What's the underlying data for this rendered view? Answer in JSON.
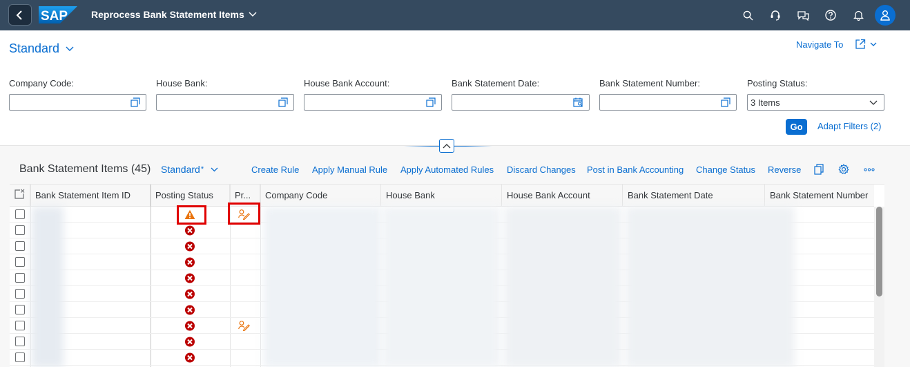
{
  "shell": {
    "logo_text": "SAP",
    "app_title": "Reprocess Bank Statement Items",
    "brand_color": "#354a5f",
    "icons": [
      "search-icon",
      "support-icon",
      "feedback-icon",
      "help-icon",
      "notifications-icon",
      "user-avatar-icon"
    ]
  },
  "header": {
    "variant": "Standard",
    "navigate_to": "Navigate To"
  },
  "filters": [
    {
      "label": "Company Code:",
      "value": ""
    },
    {
      "label": "House Bank:",
      "value": ""
    },
    {
      "label": "House Bank Account:",
      "value": ""
    },
    {
      "label": "Bank Statement Date:",
      "value": ""
    },
    {
      "label": "Bank Statement Number:",
      "value": ""
    },
    {
      "label": "Posting Status:",
      "value": "3 Items"
    }
  ],
  "filter_actions": {
    "go": "Go",
    "adapt": "Adapt Filters (2)"
  },
  "table": {
    "title": "Bank Statement Items (45)",
    "variant": "Standard",
    "variant_modified": "*",
    "toolbar_buttons": [
      "Create Rule",
      "Apply Manual Rule",
      "Apply Automated Rules",
      "Discard Changes",
      "Post in Bank Accounting",
      "Change Status",
      "Reverse"
    ],
    "columns": [
      "Bank Statement Item ID",
      "Posting Status",
      "Pr...",
      "Company Code",
      "House Bank",
      "House Bank Account",
      "Bank Statement Date",
      "Bank Statement Number"
    ],
    "rows": [
      {
        "status": "warning",
        "processing": "edit"
      },
      {
        "status": "error",
        "processing": ""
      },
      {
        "status": "error",
        "processing": ""
      },
      {
        "status": "error",
        "processing": ""
      },
      {
        "status": "error",
        "processing": ""
      },
      {
        "status": "error",
        "processing": ""
      },
      {
        "status": "error",
        "processing": ""
      },
      {
        "status": "error",
        "processing": "edit"
      },
      {
        "status": "error",
        "processing": ""
      },
      {
        "status": "error",
        "processing": ""
      }
    ]
  },
  "colors": {
    "accent": "#0a6ed1",
    "error": "#bb0000",
    "warning": "#e9730c",
    "highlight": "#e00000"
  }
}
